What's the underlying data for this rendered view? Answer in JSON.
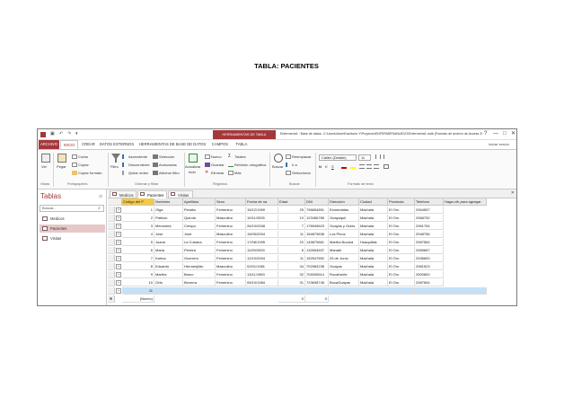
{
  "doc_title": "TABLA: PACIENTES",
  "window": {
    "context_tab": "HERRAMIENTAS DE TABLA",
    "title": "Enfermeria1 : Base de datos- C:\\Users\\User\\Escritorio Y\\Proyecto\\ENFERMERIANUEVO\\Enfermeria1.mdb (Formato de archivo de Access 2002 - 2003...",
    "help": "?",
    "minimize": "—",
    "restore": "□",
    "close": "✕"
  },
  "quick_access": {
    "save": "▣",
    "undo": "↶",
    "redo": "↷",
    "more": "▾"
  },
  "ribbon_tabs": [
    "ARCHIVO",
    "INICIO",
    "CREAR",
    "DATOS EXTERNOS",
    "HERRAMIENTAS DE BASE DE DATOS",
    "CAMPOS",
    "TABLA"
  ],
  "signin": "Iniciar sesión",
  "ribbon": {
    "ver": "Ver",
    "pegar": "Pegar",
    "cortar": "Cortar",
    "copiar": "Copiar",
    "copiar_formato": "Copiar formato",
    "filtro": "Filtro",
    "ascendente": "Ascendente",
    "descendente": "Descendente",
    "quitar_orden": "Quitar orden",
    "seleccion": "Selección",
    "avanzadas": "Avanzadas",
    "alternar_filtro": "Alternar filtro",
    "actualizar": "Actualizar",
    "todo": "todo",
    "nuevo": "Nuevo",
    "guardar": "Guardar",
    "eliminar": "Eliminar",
    "totales": "Totales",
    "revision": "Revisión ortográfica",
    "mas": "Más",
    "buscar": "Buscar",
    "reemplazar": "Reemplazar",
    "ir_a": "Ir a",
    "seleccionar": "Seleccionar",
    "font_name": "Calibri (Detalle)",
    "font_size": "11",
    "bold": "N",
    "italic": "K",
    "underline": "S",
    "groups": [
      "Vistas",
      "Portapapeles",
      "Ordenar y filtrar",
      "Registros",
      "Buscar",
      "Formato de texto"
    ]
  },
  "nav": {
    "title": "Tablas",
    "search_placeholder": "Buscar...",
    "items": [
      "Medicos",
      "Pacientes",
      "Visitas"
    ]
  },
  "doc_tabs": [
    "Medicos",
    "Pacientes",
    "Visitas"
  ],
  "columns": [
    "Codigo del P",
    "Nombres",
    "Apellidos",
    "Sexo",
    "Fecha de na",
    "Edad",
    "DNI",
    "Dirección",
    "Ciudad",
    "Provincia",
    "Telefono",
    "Haga clic para agregar"
  ],
  "rows": [
    [
      "1",
      "Olga",
      "Peralta",
      "Femenino",
      "15/12/1990",
      "25",
      "796654891",
      "Esmeraldas",
      "Machala",
      "El Oro",
      "2964557"
    ],
    [
      "2",
      "Patricio",
      "Quirola",
      "Masculino",
      "10/11/2005",
      "10",
      "123456789",
      "Guayaquil",
      "Machala",
      "El Oro",
      "2968752"
    ],
    [
      "3",
      "Mercedes",
      "Crespo",
      "Femenino",
      "26/10/2008",
      "7",
      "178945623",
      "Guayas y Octav",
      "Machala",
      "El Oro",
      "2961754"
    ],
    [
      "4",
      "Jose",
      "Jose",
      "Masculino",
      "15/05/2004",
      "11",
      "154879638",
      "Los Pinos",
      "Machala",
      "El Oro",
      "2948756"
    ],
    [
      "5",
      "Juana",
      "La Cubana",
      "Femenino",
      "17/08/1995",
      "20",
      "145879661",
      "Martha Bucara",
      "Huaquillas",
      "El Oro",
      "2987564"
    ],
    [
      "6",
      "Maria",
      "Pereira",
      "Femenino",
      "11/09/2009",
      "6",
      "132654637",
      "Manabi",
      "Machala",
      "El Oro",
      "2965667"
    ],
    [
      "7",
      "Karina",
      "Guerrero",
      "Femenino",
      "12/10/2004",
      "11",
      "152547892",
      "25 de Junio",
      "Machala",
      "El Oro",
      "2936600"
    ],
    [
      "8",
      "Eduardo",
      "Hermenjildo",
      "Masculino",
      "02/01/1981",
      "34",
      "702984238",
      "Guayas",
      "Machala",
      "El Oro",
      "2981523"
    ],
    [
      "9",
      "Martha",
      "Bravo",
      "Femenino",
      "13/11/1983",
      "32",
      "704005614",
      "Rocafuerte",
      "Machala",
      "El Oro",
      "2500800"
    ],
    [
      "10",
      "Orfa",
      "Becerra",
      "Femenino",
      "05/10/1984",
      "31",
      "723698745",
      "BocaGuayas",
      "Machala",
      "El Oro",
      "2987654"
    ],
    [
      "11",
      "",
      "",
      "",
      "",
      "",
      "",
      "",
      "",
      "",
      ""
    ]
  ],
  "new_row": {
    "label": "(Nuevo)",
    "edad": "0",
    "dni": "0",
    "marker": "✱"
  },
  "colors": {
    "accent": "#a4373a",
    "selected_row": "#c6e0f5",
    "header_active": "#f2c94c"
  }
}
